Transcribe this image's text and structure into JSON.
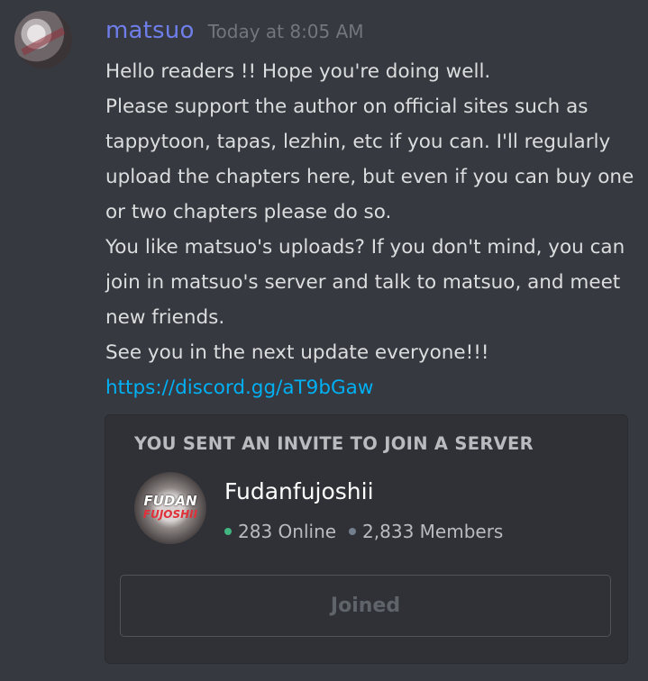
{
  "message": {
    "username": "matsuo",
    "timestamp": "Today at 8:05 AM",
    "lines": [
      "Hello readers !! Hope you're doing well.",
      "Please support the author on official sites such as tappytoon, tapas, lezhin, etc if you can. I'll regularly upload the chapters here, but even if you can buy one or two chapters please do so.",
      "You like matsuo's uploads? If you don't mind, you can join in matsuo's server and talk to matsuo, and meet new friends.",
      "See you in the next update everyone!!!"
    ],
    "link": "https://discord.gg/aT9bGaw"
  },
  "invite": {
    "header": "YOU SENT AN INVITE TO JOIN A SERVER",
    "server_name": "Fudanfujoshii",
    "icon_text_top": "FUDAN",
    "icon_text_bottom": "FUJOSHII",
    "online_count": "283 Online",
    "member_count": "2,833 Members",
    "button_label": "Joined"
  },
  "colors": {
    "background": "#36393f",
    "username": "#6f7eea",
    "link": "#00b0f4",
    "online_dot": "#43b581",
    "embed_background": "#2f3136"
  }
}
